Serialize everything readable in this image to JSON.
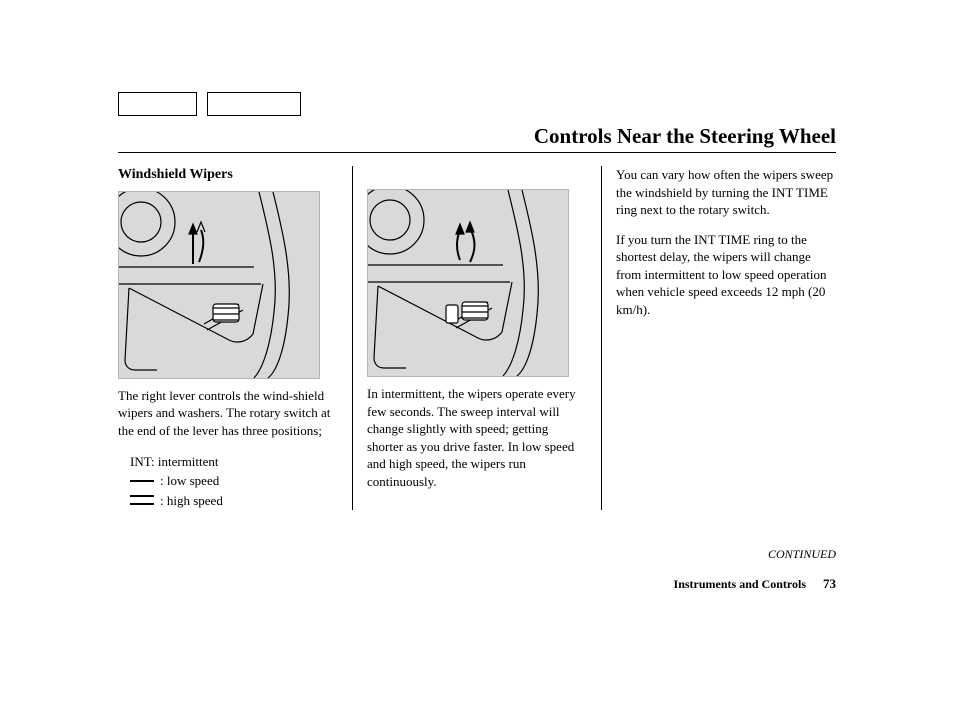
{
  "title": "Controls Near the Steering Wheel",
  "subhead": "Windshield Wipers",
  "col1": {
    "p1": "The right lever controls the wind-shield wipers and washers. The rotary switch at the end of the lever has three positions;",
    "legend": {
      "int": "INT: intermittent",
      "low": ": low speed",
      "high": ": high speed"
    }
  },
  "col2": {
    "p1": "In intermittent, the wipers operate every few seconds. The sweep interval will change slightly with speed; getting shorter as you drive faster. In low speed and high speed, the wipers run continuously."
  },
  "col3": {
    "p1": "You can vary how often the wipers sweep the windshield by turning the INT TIME ring next to the rotary switch.",
    "p2": "If you turn the INT TIME ring to the shortest delay, the wipers will change from intermittent to low speed operation when vehicle speed exceeds 12 mph (20 km/h)."
  },
  "continued": "CONTINUED",
  "footer_section": "Instruments and Controls",
  "page_number": "73"
}
